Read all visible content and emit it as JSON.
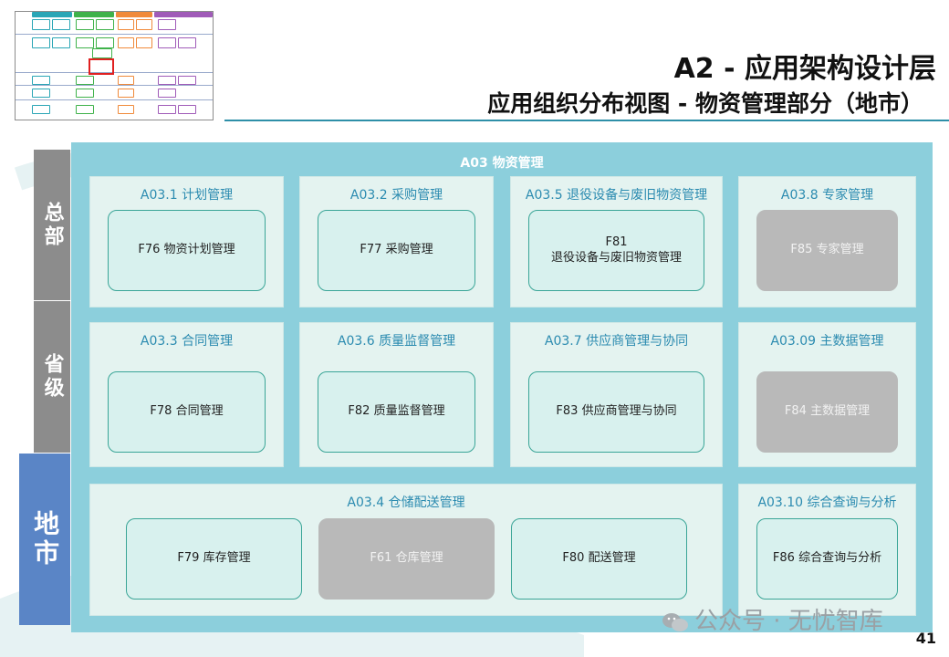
{
  "header": {
    "title": "A2 - 应用架构设计层",
    "subtitle": "应用组织分布视图 - 物资管理部分（地市）"
  },
  "levels": {
    "headquarters": "总部",
    "province": "省级",
    "city": "地市"
  },
  "domain": {
    "title": "A03 物资管理",
    "groups": [
      {
        "id": "g1",
        "title": "A03.1 计划管理",
        "functions": [
          {
            "label": "F76 物资计划管理",
            "available": true
          }
        ]
      },
      {
        "id": "g2",
        "title": "A03.2 采购管理",
        "functions": [
          {
            "label": "F77 采购管理",
            "available": true
          }
        ]
      },
      {
        "id": "g3",
        "title": "A03.5 退役设备与废旧物资管理",
        "functions": [
          {
            "label": "F81\n退役设备与废旧物资管理",
            "available": true
          }
        ]
      },
      {
        "id": "g4",
        "title": "A03.8 专家管理",
        "functions": [
          {
            "label": "F85 专家管理",
            "available": false
          }
        ]
      },
      {
        "id": "g5",
        "title": "A03.3 合同管理",
        "functions": [
          {
            "label": "F78 合同管理",
            "available": true
          }
        ]
      },
      {
        "id": "g6",
        "title": "A03.6 质量监督管理",
        "functions": [
          {
            "label": "F82 质量监督管理",
            "available": true
          }
        ]
      },
      {
        "id": "g7",
        "title": "A03.7 供应商管理与协同",
        "functions": [
          {
            "label": "F83 供应商管理与协同",
            "available": true
          }
        ]
      },
      {
        "id": "g8",
        "title": "A03.09 主数据管理",
        "functions": [
          {
            "label": "F84 主数据管理",
            "available": false
          }
        ]
      },
      {
        "id": "g9",
        "title": "A03.4 仓储配送管理",
        "functions": [
          {
            "label": "F79 库存管理",
            "available": true
          },
          {
            "label": "F61 仓库管理",
            "available": false
          },
          {
            "label": "F80 配送管理",
            "available": true
          }
        ]
      },
      {
        "id": "g10",
        "title": "A03.10 综合查询与分析",
        "functions": [
          {
            "label": "F86 综合查询与分析",
            "available": true
          }
        ]
      }
    ]
  },
  "footer": {
    "watermark": "公众号 · 无忧智库",
    "page_number": "41"
  },
  "colors": {
    "domain_background": "#8ccfdc",
    "group_background": "#e4f3f0",
    "function_available": "#d8f1ee",
    "function_unavailable": "#b9b9b9",
    "level_grey": "#8c8c8c",
    "level_city": "#5a85c6",
    "group_title": "#2b8bb0"
  }
}
